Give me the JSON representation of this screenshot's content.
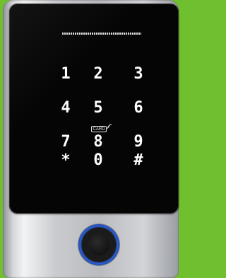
{
  "device": {
    "keypad": {
      "keys": [
        "1",
        "2",
        "3",
        "4",
        "5",
        "6",
        "7",
        "8",
        "9",
        "*",
        "0",
        "#"
      ]
    },
    "card_reader_label": "CARD",
    "colors": {
      "background": "#6fbf2e",
      "glass": "#050505",
      "key_text": "#ffffff",
      "sensor_ring": "#2f62d8"
    },
    "icons": {
      "card_reader": "rfid-card-icon",
      "sensor": "fingerprint-sensor-icon"
    }
  }
}
